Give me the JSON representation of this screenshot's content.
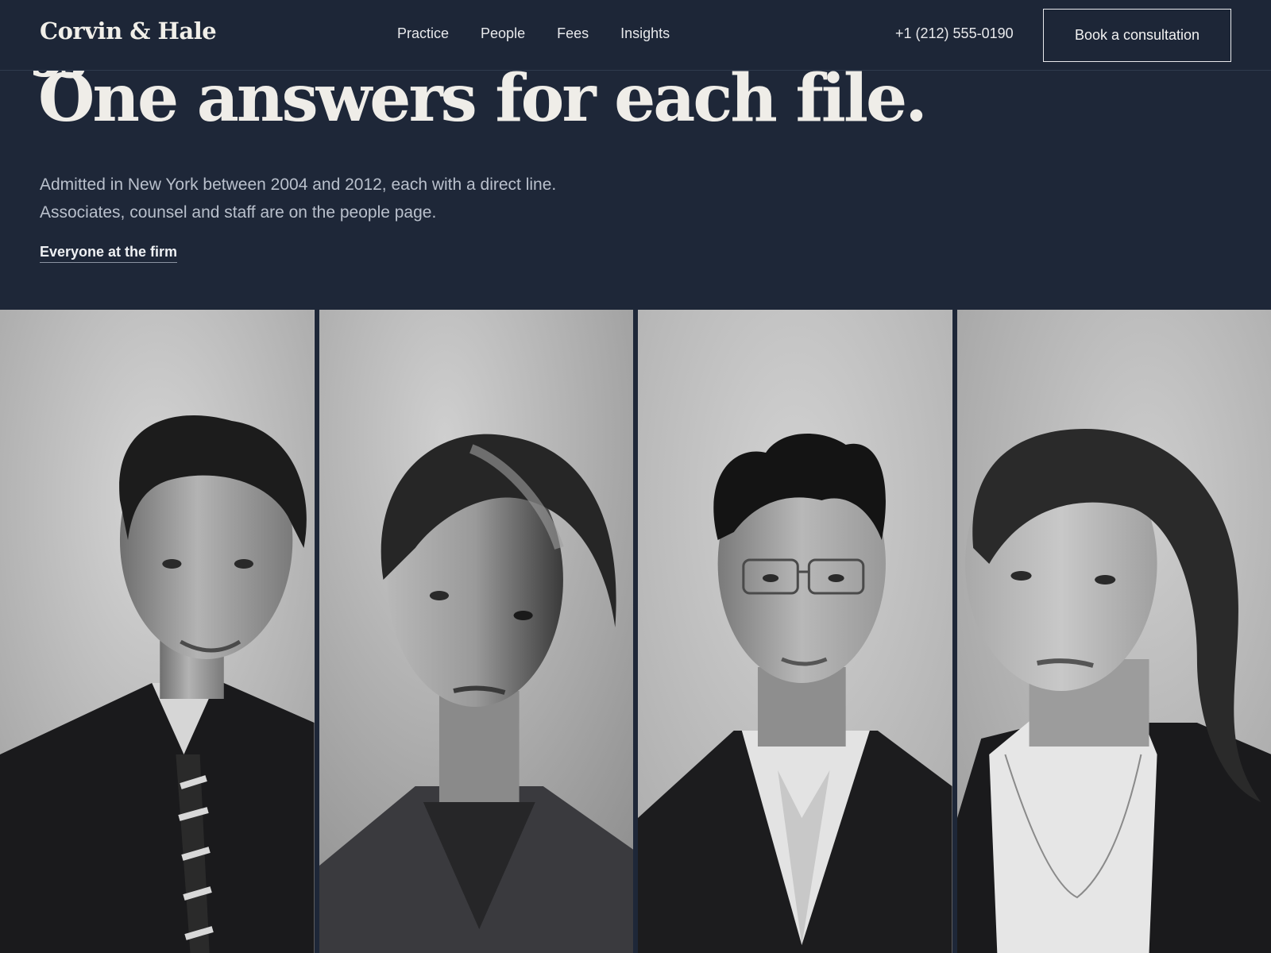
{
  "header": {
    "logo": "Corvin & Hale",
    "nav": [
      "Practice",
      "People",
      "Fees",
      "Insights"
    ],
    "phone": "+1 (212) 555-0190",
    "cta": "Book a consultation"
  },
  "hero": {
    "headline": "One answers for each file.",
    "lede": "Admitted in New York between 2004 and 2012, each with a direct line. Associates, counsel and staff are on the people page.",
    "link": "Everyone at the firm"
  },
  "portraits": [
    "man-striped-tie",
    "woman-updo",
    "man-glasses",
    "woman-turtleneck"
  ]
}
